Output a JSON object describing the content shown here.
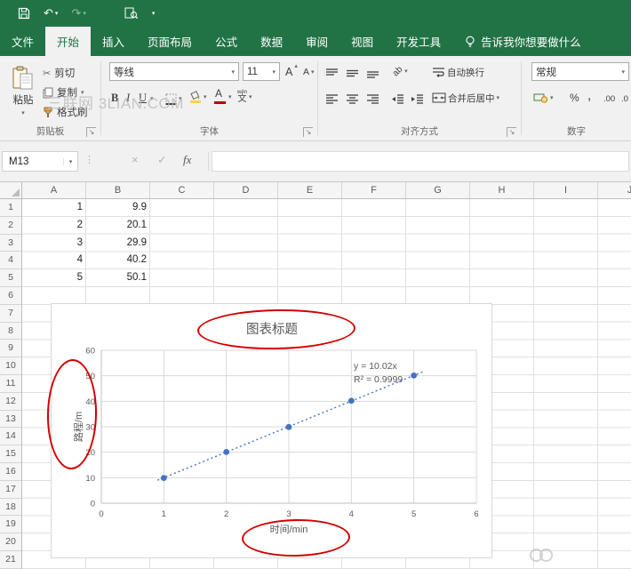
{
  "app": {
    "theme_green": "#217346",
    "watermark": "三联网 3LIAN.COM"
  },
  "icons": {
    "caret": "▾",
    "caret_up": "▴",
    "undo": "↶",
    "redo": "↷",
    "scissors": "✂",
    "cancel": "×",
    "enter": "✓",
    "dialog_launcher": "↘",
    "gripper": "⋮",
    "letter_a": "A",
    "orientation": "ab"
  },
  "tabs": [
    {
      "label": "文件"
    },
    {
      "label": "开始"
    },
    {
      "label": "插入"
    },
    {
      "label": "页面布局"
    },
    {
      "label": "公式"
    },
    {
      "label": "数据"
    },
    {
      "label": "审阅"
    },
    {
      "label": "视图"
    },
    {
      "label": "开发工具"
    }
  ],
  "tell_me": {
    "label": "告诉我你想要做什么"
  },
  "ribbon": {
    "clipboard": {
      "paste": "粘贴",
      "cut": "剪切",
      "copy": "复制",
      "format_painter": "格式刷",
      "group_label": "剪贴板"
    },
    "font": {
      "font_name": "等线",
      "font_size": "11",
      "bold": "B",
      "italic": "I",
      "underline": "U",
      "phonetic_top": "wén",
      "phonetic_bottom": "文",
      "group_label": "字体"
    },
    "alignment": {
      "wrap_text": "自动换行",
      "merge_center": "合并后居中",
      "group_label": "对齐方式"
    },
    "number": {
      "format": "常规",
      "percent": "%",
      "comma": ",",
      "inc_decimal": ".00",
      "dec_decimal": ".0",
      "group_label": "数字"
    }
  },
  "formula_bar": {
    "name_box": "M13",
    "fx": "fx",
    "value": ""
  },
  "grid": {
    "columns": [
      "A",
      "B",
      "C",
      "D",
      "E",
      "F",
      "G",
      "H",
      "I",
      "J"
    ],
    "rows": [
      "1",
      "2",
      "3",
      "4",
      "5",
      "6",
      "7",
      "8",
      "9",
      "10",
      "11",
      "12",
      "13",
      "14",
      "15",
      "16",
      "17",
      "18",
      "19",
      "20",
      "21"
    ],
    "data_rows": [
      {
        "row": "1",
        "A": "1",
        "B": "9.9"
      },
      {
        "row": "2",
        "A": "2",
        "B": "20.1"
      },
      {
        "row": "3",
        "A": "3",
        "B": "29.9"
      },
      {
        "row": "4",
        "A": "4",
        "B": "40.2"
      },
      {
        "row": "5",
        "A": "5",
        "B": "50.1"
      }
    ]
  },
  "chart_data": {
    "type": "scatter",
    "title": "图表标题",
    "xlabel": "时间/min",
    "ylabel": "路程/m",
    "x": [
      1,
      2,
      3,
      4,
      5
    ],
    "y": [
      9.9,
      20.1,
      29.9,
      40.2,
      50.1
    ],
    "xlim": [
      0,
      6
    ],
    "ylim": [
      0,
      60
    ],
    "xticks": [
      0,
      1,
      2,
      3,
      4,
      5,
      6
    ],
    "yticks": [
      0,
      10,
      20,
      30,
      40,
      50,
      60
    ],
    "grid": true,
    "legend": false,
    "point_color": "#4472c4",
    "trendline": {
      "label": "y = 10.02x",
      "r2": "R² = 0.9999",
      "slope": 10.02,
      "style": "dotted",
      "x_start": 0.9,
      "x_end": 5.15
    }
  },
  "annotations": {
    "color": "#d40000"
  }
}
